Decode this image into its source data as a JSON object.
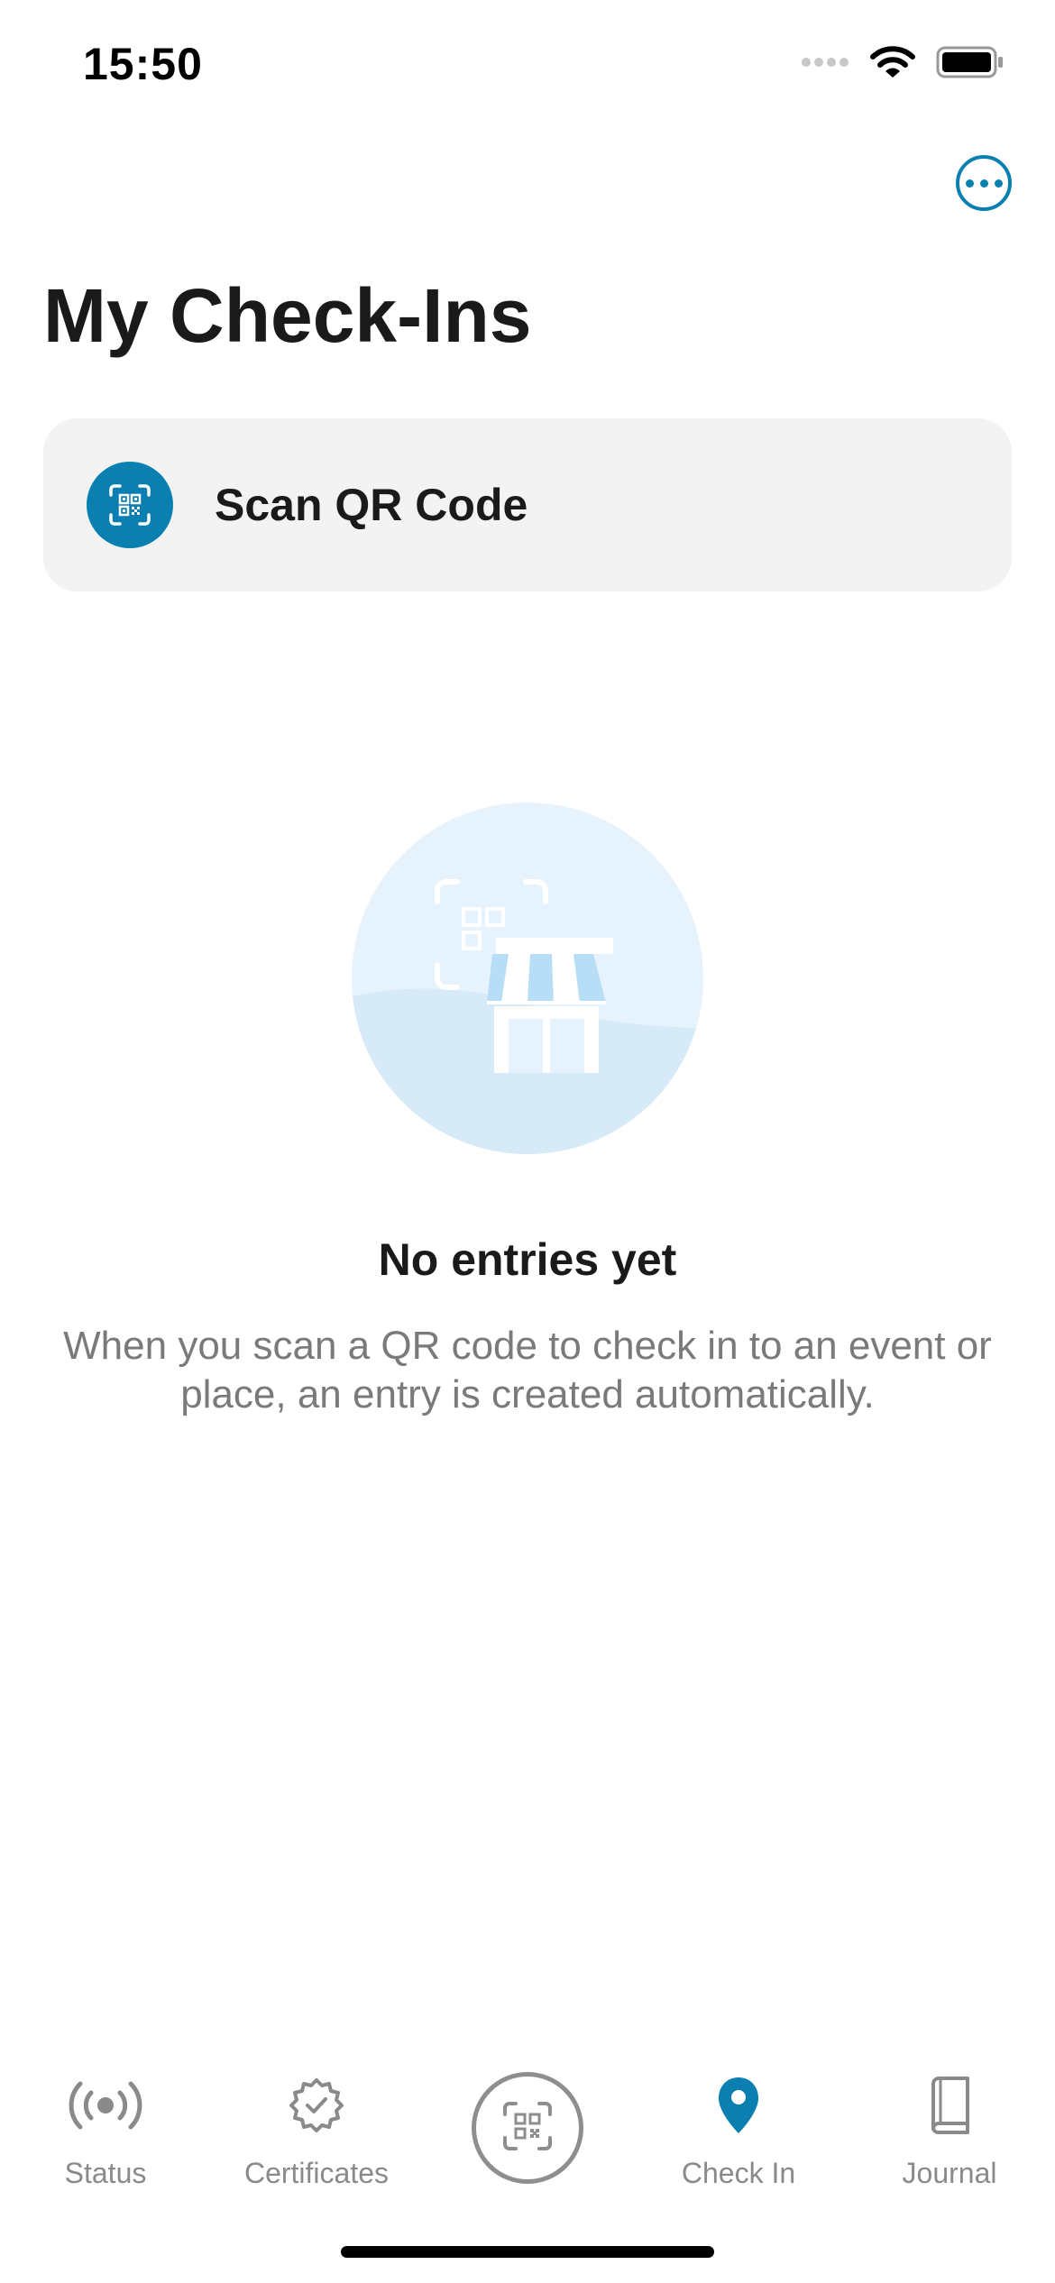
{
  "status_bar": {
    "time": "15:50",
    "icons": [
      "cellular-signal-icon",
      "wifi-icon",
      "battery-icon"
    ]
  },
  "header": {
    "more_icon": "ellipsis-circle-icon",
    "title": "My Check-Ins"
  },
  "scan_card": {
    "icon": "qr-scan-icon",
    "label": "Scan QR Code"
  },
  "empty_state": {
    "illustration": "storefront-qr-illustration",
    "title": "No entries yet",
    "description": "When you scan a QR code to check in to an event or place, an entry is created automatically."
  },
  "tabbar": {
    "tabs": [
      {
        "label": "Status",
        "icon": "broadcast-icon",
        "active": false
      },
      {
        "label": "Certificates",
        "icon": "certificate-badge-icon",
        "active": false
      },
      {
        "label": "",
        "icon": "qr-scan-icon",
        "active": false
      },
      {
        "label": "Check In",
        "icon": "location-pin-icon",
        "active": true
      },
      {
        "label": "Journal",
        "icon": "book-icon",
        "active": false
      }
    ]
  },
  "colors": {
    "accent": "#0a7fb0",
    "inactive": "#8a8a8a",
    "card_bg": "#f3f3f3",
    "illustration_bg": "#e6f3fc"
  }
}
